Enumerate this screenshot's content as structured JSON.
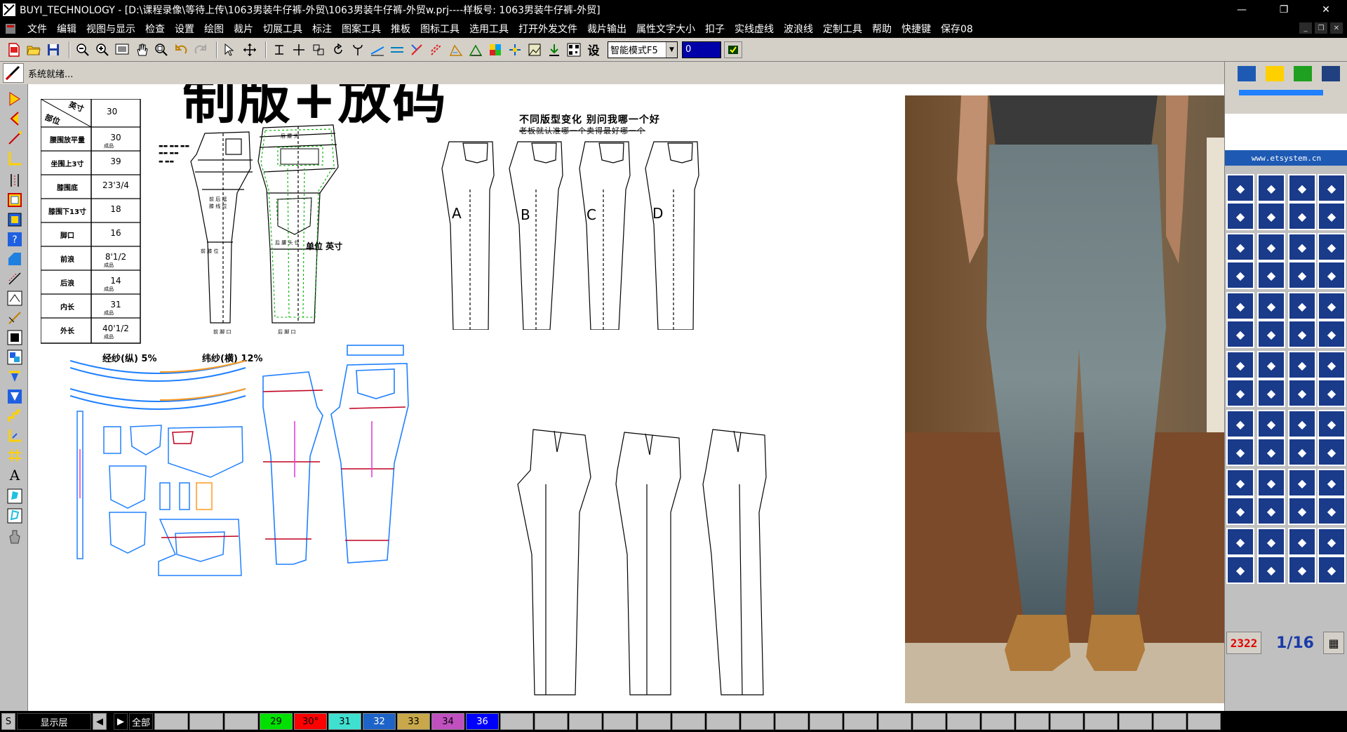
{
  "window": {
    "title": "BUYI_TECHNOLOGY - [D:\\课程录像\\等待上传\\1063男装牛仔裤-外贸\\1063男装牛仔裤-外贸w.prj----样板号: 1063男装牛仔裤-外贸]",
    "controls": {
      "minimize": "—",
      "restore": "❐",
      "close": "✕"
    }
  },
  "menu": [
    "文件",
    "编辑",
    "视图与显示",
    "检查",
    "设置",
    "绘图",
    "裁片",
    "切展工具",
    "标注",
    "图案工具",
    "推板",
    "图标工具",
    "选用工具",
    "打开外发文件",
    "裁片输出",
    "属性文字大小",
    "扣子",
    "实线虚线",
    "波浪线",
    "定制工具",
    "帮助",
    "快捷键",
    "保存08"
  ],
  "toolbar": {
    "mode_label": "智能模式F5",
    "mode_arrow": "▼",
    "value_input": "0",
    "set_label": "设"
  },
  "status": {
    "text": "系统就绪..."
  },
  "overlay": {
    "headline": "制版+放码"
  },
  "size_table": {
    "header_top": "英寸",
    "header_bottom": "部位",
    "header_value": "30",
    "rows": [
      {
        "label": "腰围放平量",
        "value": "30",
        "sub": "成品"
      },
      {
        "label": "坐围上3寸",
        "value": "39",
        "sub": ""
      },
      {
        "label": "膝围底",
        "value": "23'3/4",
        "sub": ""
      },
      {
        "label": "膝围下13寸",
        "value": "18",
        "sub": ""
      },
      {
        "label": "脚口",
        "value": "16",
        "sub": ""
      },
      {
        "label": "前浪",
        "value": "8'1/2",
        "sub": "成品"
      },
      {
        "label": "后浪",
        "value": "14",
        "sub": "成品"
      },
      {
        "label": "内长",
        "value": "31",
        "sub": "成品"
      },
      {
        "label": "外长",
        "value": "40'1/2",
        "sub": "成品"
      }
    ]
  },
  "draft_labels": {
    "unit_note": "单位 英寸",
    "variant_title": "不同版型变化  别问我哪一个好",
    "variant_sub": "老板就认准哪一个卖得最好哪一个",
    "variants": [
      "A",
      "B",
      "C",
      "D"
    ],
    "shrink_warp": "经纱(纵) 5%",
    "shrink_weft": "纬纱(横) 12%"
  },
  "right_panel": {
    "url": "www.etsystem.cn",
    "counter": "2322",
    "fraction": "1/16",
    "calc_icon": "calculator-icon"
  },
  "layer_bar": {
    "s_label": "S",
    "layer_label": "显示层",
    "prev": "◀",
    "next": "▶",
    "all_label": "全部",
    "layers": [
      {
        "label": "29",
        "color": "#00e000"
      },
      {
        "label": "30°",
        "color": "#ff0000"
      },
      {
        "label": "31",
        "color": "#40e0d0"
      },
      {
        "label": "32",
        "color": "#1e64c8"
      },
      {
        "label": "33",
        "color": "#c8a84a"
      },
      {
        "label": "34",
        "color": "#c050c0"
      },
      {
        "label": "36",
        "color": "#0000ff"
      }
    ]
  },
  "colors": {
    "pattern_green": "#00b000",
    "pattern_blue": "#2080ff",
    "pattern_red": "#c00020",
    "pattern_orange": "#ff9a20",
    "pattern_magenta": "#e040e0"
  }
}
